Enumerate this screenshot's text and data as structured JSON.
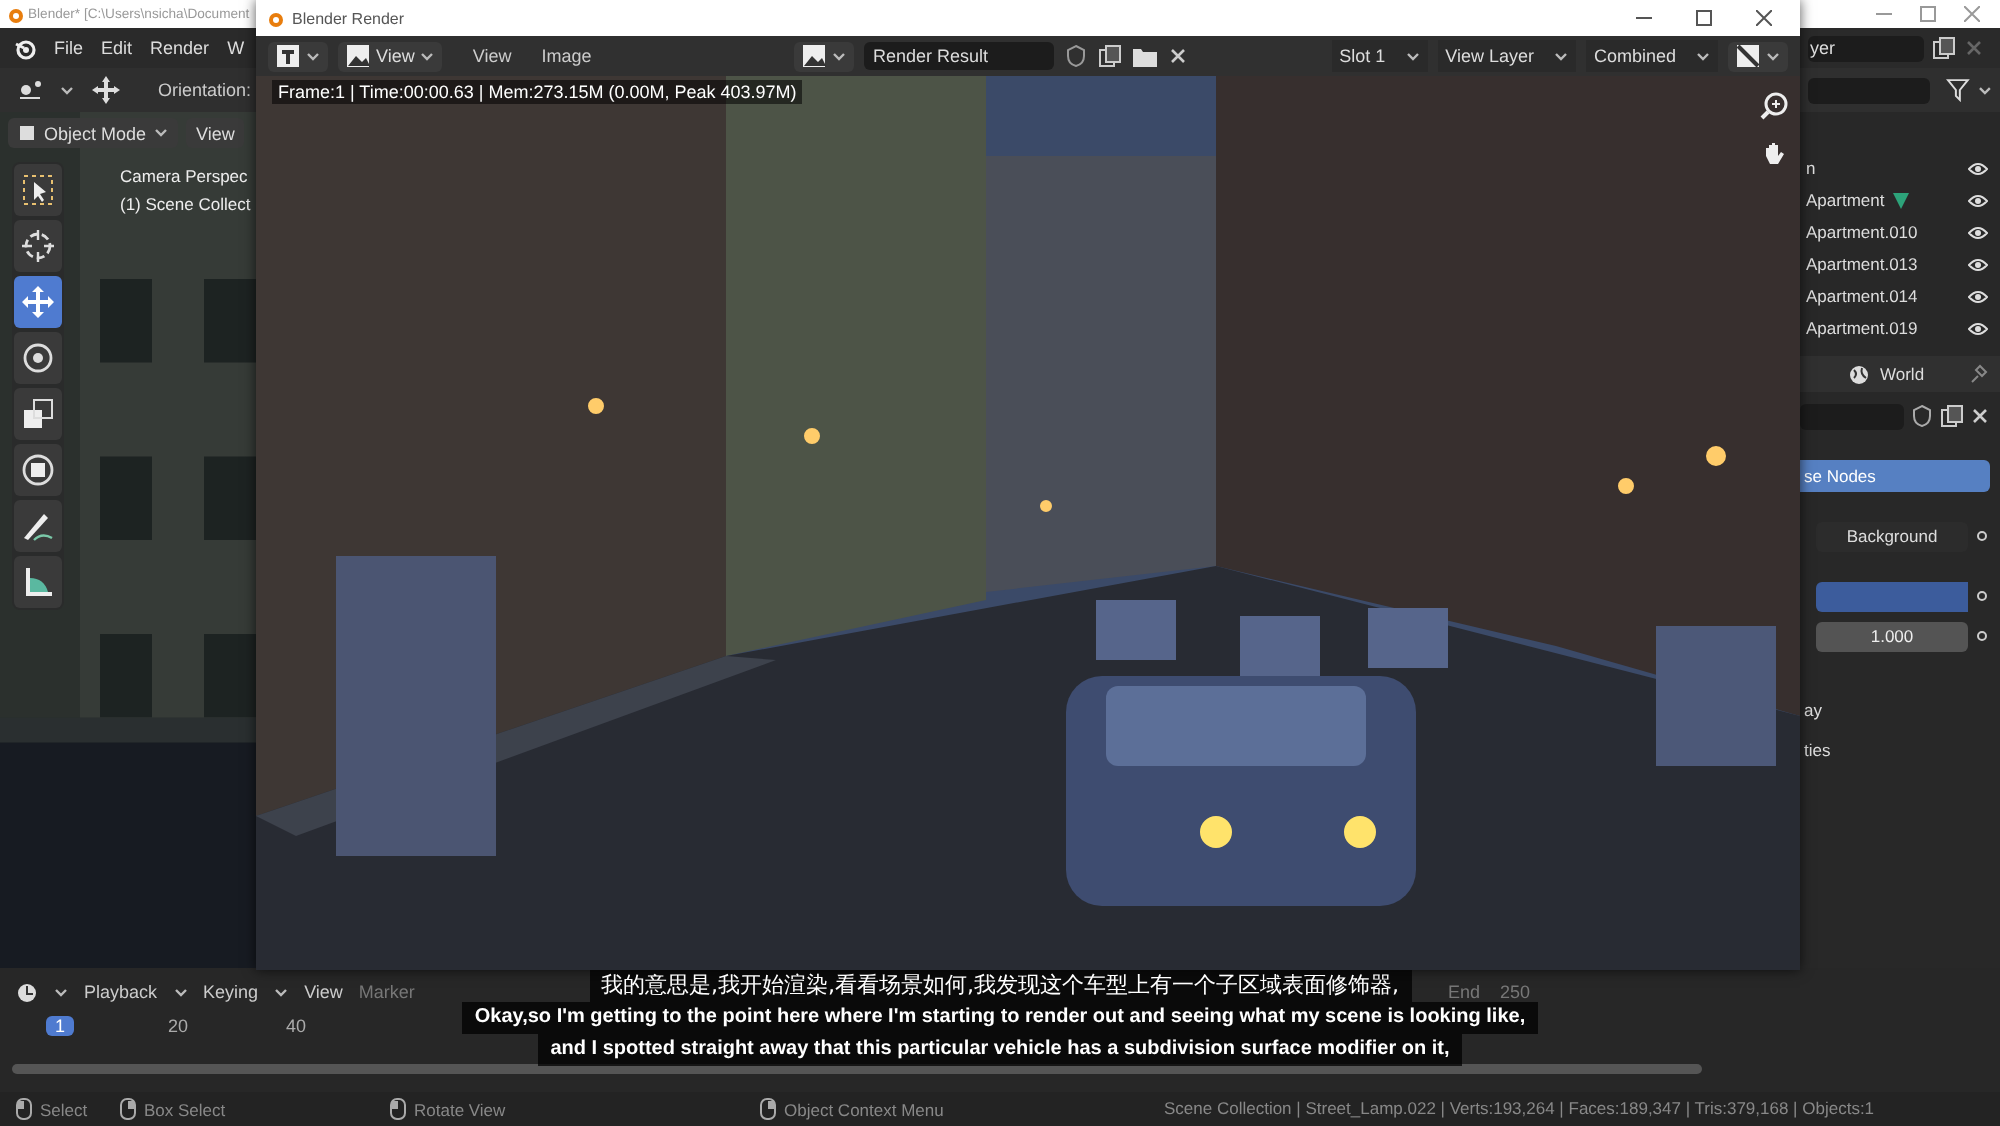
{
  "main_window": {
    "title": "Blender* [C:\\Users\\nsicha\\Document",
    "menu": [
      "File",
      "Edit",
      "Render",
      "W"
    ],
    "view_layer_field": "yer",
    "tool_header": {
      "orientation_label": "Orientation:"
    },
    "viewport_header": {
      "mode": "Object Mode",
      "menus": [
        "View"
      ]
    },
    "viewport": {
      "overlay": [
        "Camera Perspec",
        "(1) Scene Collect"
      ],
      "tools": [
        {
          "kind": "select",
          "selected": false
        },
        {
          "kind": "cursor",
          "selected": false
        },
        {
          "kind": "move",
          "selected": true
        },
        {
          "kind": "rotate",
          "selected": false
        },
        {
          "kind": "scale",
          "selected": false
        },
        {
          "kind": "transform",
          "selected": false
        },
        {
          "kind": "annotate",
          "selected": false
        },
        {
          "kind": "measure",
          "selected": false
        }
      ]
    },
    "outliner": {
      "rows": [
        {
          "label": "n",
          "data_icon": false
        },
        {
          "label": "Apartment",
          "data_icon": true
        },
        {
          "label": "Apartment.010",
          "data_icon": false
        },
        {
          "label": "Apartment.013",
          "data_icon": false
        },
        {
          "label": "Apartment.014",
          "data_icon": false
        },
        {
          "label": "Apartment.019",
          "data_icon": false
        }
      ]
    },
    "properties": {
      "tab": "World",
      "rows": [
        {
          "kind": "datablock"
        },
        {
          "kind": "toggle",
          "label": "se Nodes"
        },
        {
          "kind": "dropdown",
          "label": "Background"
        },
        {
          "kind": "swatch"
        },
        {
          "kind": "number",
          "label": "1.000"
        },
        {
          "kind": "text",
          "label": "ay"
        },
        {
          "kind": "text",
          "label": "ties"
        }
      ]
    },
    "timeline": {
      "menus": [
        "Playback",
        "Keying",
        "View",
        "Marker"
      ],
      "frames": [
        {
          "label": "1",
          "selected": true
        },
        {
          "label": "20",
          "selected": false
        },
        {
          "label": "40",
          "selected": false
        }
      ],
      "end_label": "End",
      "end_value": "250"
    },
    "status_bar": {
      "hints": [
        "Select",
        "Box Select",
        "Rotate View",
        "Object Context Menu"
      ],
      "stats": "Scene Collection | Street_Lamp.022 | Verts:193,264 | Faces:189,347 | Tris:379,168 | Objects:1"
    }
  },
  "render_window": {
    "title": "Blender Render",
    "mode_dropdown": "View",
    "menus": [
      "View",
      "Image"
    ],
    "image_name": "Render Result",
    "slot": "Slot 1",
    "layer": "View Layer",
    "pass": "Combined",
    "info": "Frame:1 | Time:00:00.63 | Mem:273.15M (0.00M, Peak 403.97M)"
  },
  "subtitles": [
    "我的意思是,我开始渲染,看看场景如何,我发现这个车型上有一个子区域表面修饰器,",
    "Okay,so I'm getting to the point here where I'm starting to render out and seeing what my scene is looking like,",
    "and I spotted straight away that this particular vehicle has a subdivision surface modifier on it,"
  ]
}
